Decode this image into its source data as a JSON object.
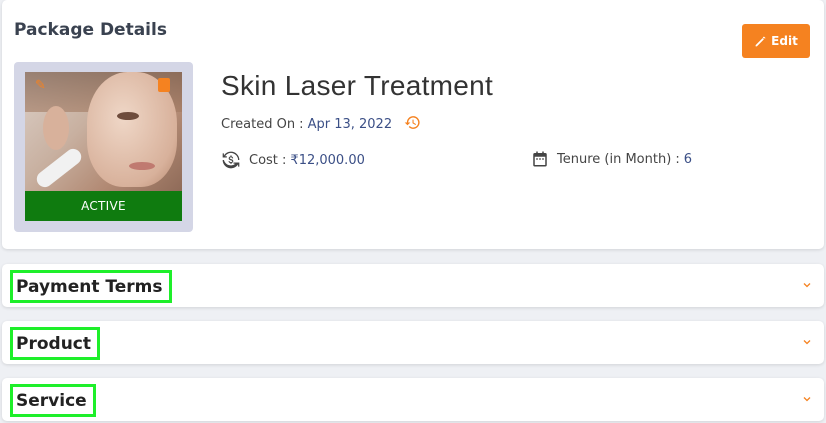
{
  "package": {
    "title": "Package Details",
    "edit_label": "Edit",
    "name": "Skin Laser Treatment",
    "status": "ACTIVE",
    "created_label": "Created On :",
    "created_value": "Apr 13, 2022",
    "cost_label": "Cost :",
    "cost_value": "₹12,000.00",
    "tenure_label": "Tenure (in Month) :",
    "tenure_value": "6"
  },
  "sections": {
    "payment_terms": "Payment Terms",
    "product": "Product",
    "service": "Service"
  },
  "colors": {
    "accent": "#f58220",
    "active": "#0f7b0f",
    "value_text": "#3b4f86",
    "highlight_box": "#1eef2a"
  },
  "icons": {
    "edit": "pencil-icon",
    "history": "history-icon",
    "cost": "currency-exchange-icon",
    "tenure": "calendar-icon",
    "expand": "chevron-down-icon"
  }
}
